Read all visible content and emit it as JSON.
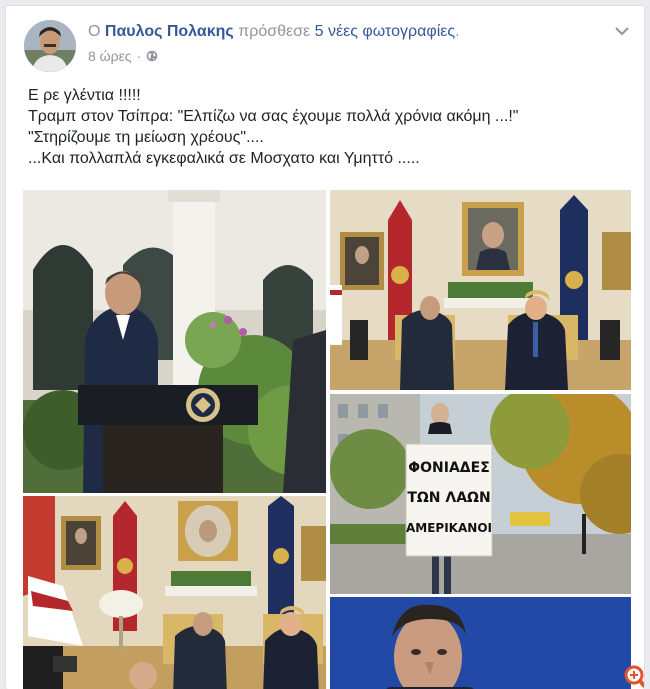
{
  "post": {
    "article": "Ο",
    "author": "Παυλος Πολακης",
    "action": "πρόσθεσε",
    "photo_count_link": "5 νέες φωτογραφίες",
    "period": ".",
    "time": "8 ώρες",
    "separator": "·",
    "privacy_icon": "globe-icon",
    "text_lines": [
      "Ε ρε γλέντια !!!!!",
      "Τραμπ στον Τσίπρα: \"Ελπίζω να σας έχουμε πολλά χρόνια ακόμη ...!\"",
      "\"Στηρίζουμε τη μείωση χρέους\"....",
      "...Και πολλαπλά εγκεφαλικά σε Μοσχατο και Υμηττό ....."
    ]
  },
  "photos": {
    "protest_sign_line1": "ΦΟΝΙΑΔΕΣ",
    "protest_sign_line2": "ΤΩΝ ΛΑΩΝ",
    "protest_sign_line3": "ΑΜΕΡΙΚΑΝΟΙ"
  },
  "colors": {
    "link": "#365899",
    "meta": "#90949c",
    "text": "#1d2129",
    "zoom_icon": "#e0542e"
  }
}
